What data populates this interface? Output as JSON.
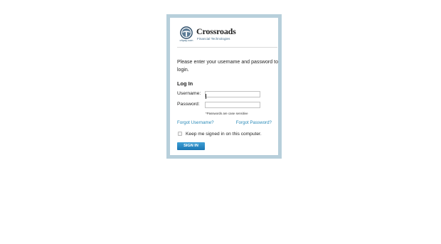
{
  "brand": {
    "name": "Crossroads",
    "tagline": "Financial Technologies",
    "logo_caption": "cftpay.com",
    "logo_icon": "steering-wheel-icon"
  },
  "login": {
    "intro": "Please enter your username and password to login.",
    "heading": "Log In",
    "username_label": "Username:",
    "username_value": "",
    "password_label": "Password:",
    "password_value": "",
    "password_hint": "*Passwords are case sensitive",
    "forgot_username": "Forgot Username?",
    "forgot_password": "Forgot Password?",
    "keep_signed_in": "Keep me signed in on this computer.",
    "keep_signed_in_checked": false,
    "signin_label": "SIGN IN"
  },
  "colors": {
    "frame_border": "#b7cfdb",
    "link": "#2a8ab8",
    "button": "#1a75b2"
  }
}
